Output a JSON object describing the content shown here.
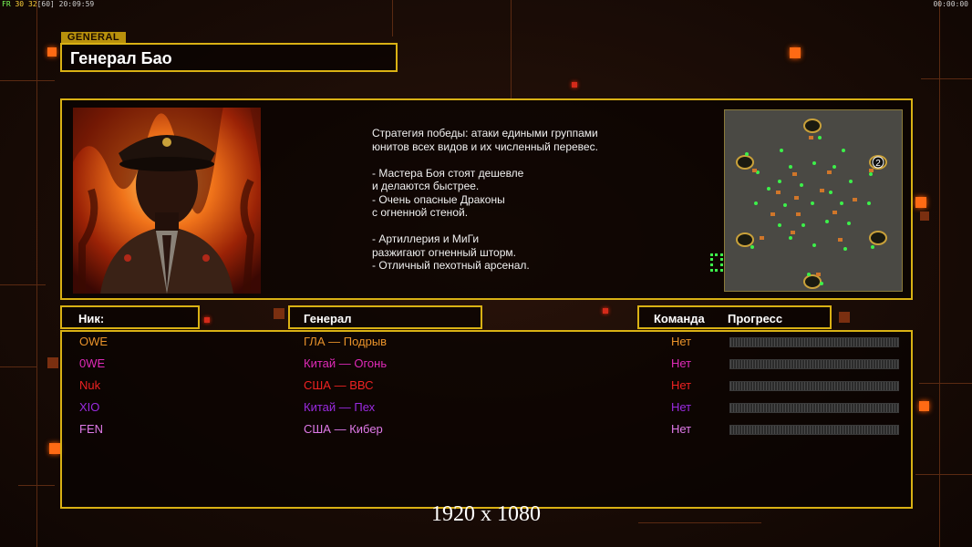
{
  "topbar": {
    "fps_label": "FR",
    "fps_value": "30",
    "fps_cap": "32",
    "fps_max": "[60]",
    "clock": "20:09:59",
    "timer": "00:00:00"
  },
  "header": {
    "tag": "GENERAL",
    "title": "Генерал Бао"
  },
  "description": "Стратегия победы: атаки едиными группами\nюнитов всех видов и их численный перевес.\n\n- Мастера Боя стоят дешевле\nи делаются быстрее.\n- Очень опасные Драконы\nс огненной стеной.\n\n- Артиллерия и МиГи\nразжигают огненный шторм.\n- Отличный пехотный арсенал.",
  "minimap": {
    "start_label": "2"
  },
  "columns": {
    "nick": "Ник:",
    "general": "Генерал",
    "team": "Команда",
    "progress": "Прогресс"
  },
  "players": [
    {
      "nick": "OWE",
      "general": "ГЛА — Подрыв",
      "team": "Нет",
      "color": "#e8922a",
      "progress": 0
    },
    {
      "nick": "0WE",
      "general": "Китай — Огонь",
      "team": "Нет",
      "color": "#e02ab8",
      "progress": 0
    },
    {
      "nick": "Nuk",
      "general": "США — ВВС",
      "team": "Нет",
      "color": "#ee2222",
      "progress": 0
    },
    {
      "nick": "XIO",
      "general": "Китай — Пех",
      "team": "Нет",
      "color": "#9a2ae0",
      "progress": 0
    },
    {
      "nick": "FEN",
      "general": "США — Кибер",
      "team": "Нет",
      "color": "#e07ae8",
      "progress": 0
    }
  ],
  "resolution": "1920 x 1080"
}
